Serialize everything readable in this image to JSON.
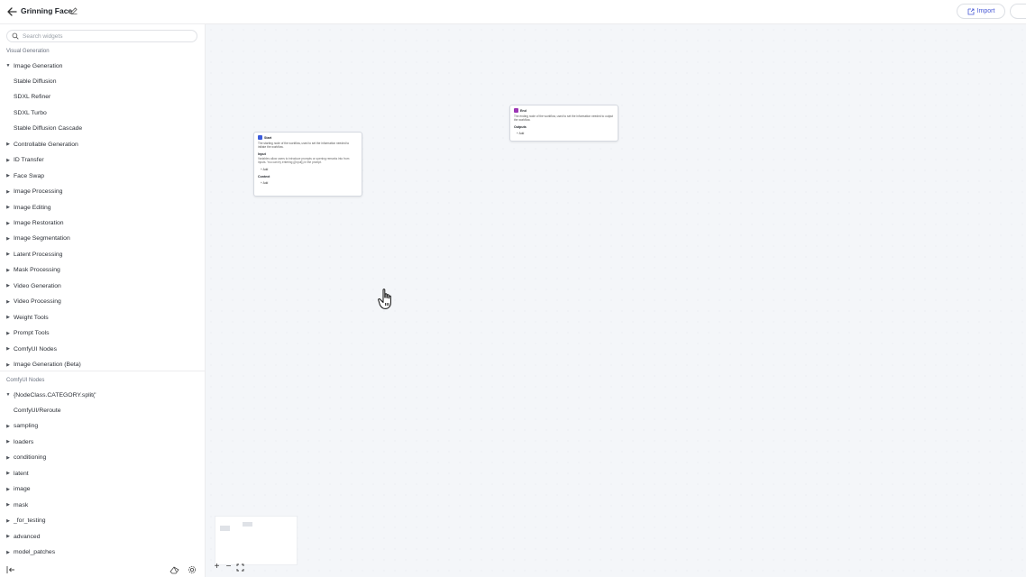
{
  "header": {
    "title": "Grinning Face",
    "import_label": "Import"
  },
  "sidebar": {
    "search_placeholder": "Search widgets",
    "section1_label": "Visual Generation",
    "section2_label": "ComfyUI Nodes",
    "visual_items": [
      {
        "label": "Image Generation",
        "expanded": true
      },
      {
        "label": "Stable Diffusion",
        "child": true
      },
      {
        "label": "SDXL Refiner",
        "child": true
      },
      {
        "label": "SDXL Turbo",
        "child": true
      },
      {
        "label": "Stable Diffusion Cascade",
        "child": true
      },
      {
        "label": "Controllable Generation"
      },
      {
        "label": "ID Transfer"
      },
      {
        "label": "Face Swap"
      },
      {
        "label": "Image Processing"
      },
      {
        "label": "Image Editing"
      },
      {
        "label": "Image Restoration"
      },
      {
        "label": "Image Segmentation"
      },
      {
        "label": "Latent Processing"
      },
      {
        "label": "Mask Processing"
      },
      {
        "label": "Video Generation"
      },
      {
        "label": "Video Processing"
      },
      {
        "label": "Weight Tools"
      },
      {
        "label": "Prompt Tools"
      },
      {
        "label": "ComfyUI Nodes"
      },
      {
        "label": "Image Generation (Beta)"
      }
    ],
    "comfy_items": [
      {
        "label": "{NodeClass.CATEGORY.split('",
        "expanded": true
      },
      {
        "label": "ComfyUI/Reroute",
        "child": true
      },
      {
        "label": "sampling"
      },
      {
        "label": "loaders"
      },
      {
        "label": "conditioning"
      },
      {
        "label": "latent"
      },
      {
        "label": "image"
      },
      {
        "label": "mask"
      },
      {
        "label": "_for_testing"
      },
      {
        "label": "advanced"
      },
      {
        "label": "model_patches"
      }
    ]
  },
  "canvas": {
    "start_node": {
      "title": "Start",
      "desc": "The starting node of the workflow, used to set the information needed to initiate the workflow.",
      "input_label": "Input",
      "input_desc": "Variables allow users to introduce prompts or opening remarks into from inputs. You can try entering {{input}} in the prompt.",
      "add_label": "+ Add",
      "context_label": "Context",
      "context_add": "+ Add",
      "icon_color": "#3b5bdb"
    },
    "end_node": {
      "title": "End",
      "desc": "The ending node of the workflow, used to set the information needed to output the workflow.",
      "outputs_label": "Outputs",
      "add_label": "+ Add",
      "icon_color": "#9c36b5"
    }
  },
  "colors": {
    "accent": "#4a5bd6",
    "canvas_bg": "#f4f6f9"
  }
}
